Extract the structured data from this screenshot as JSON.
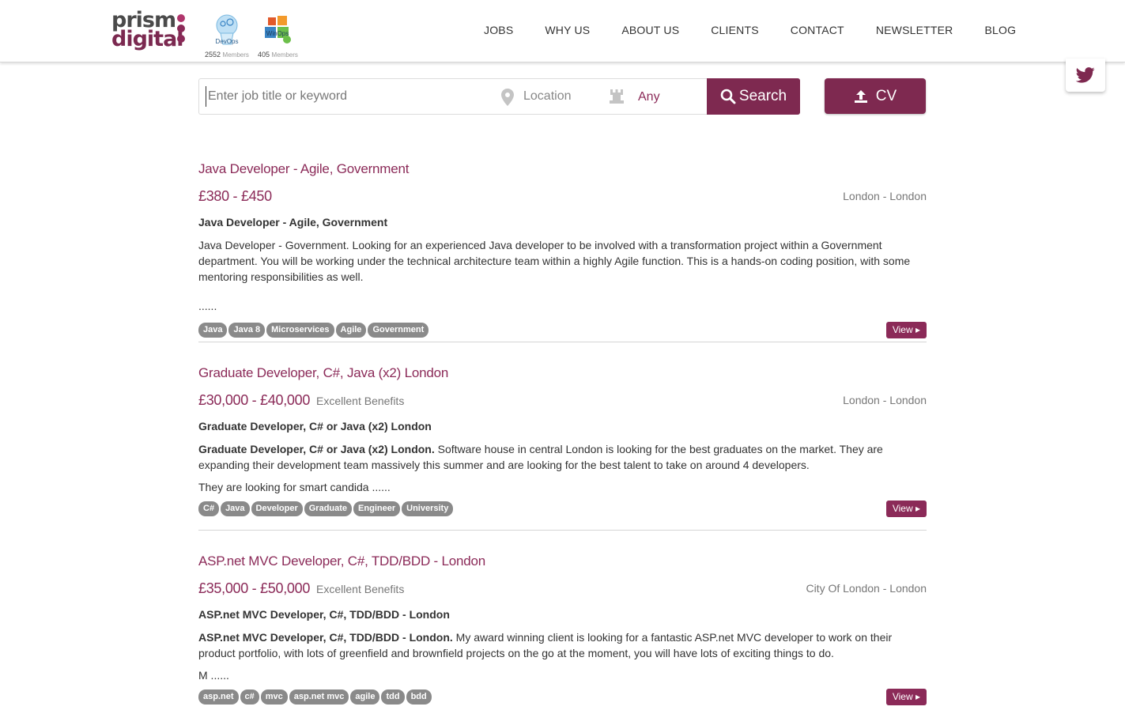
{
  "brand": {
    "logo_line1": "prism",
    "logo_line2": "digital"
  },
  "communities": [
    {
      "name": "DevOps",
      "count": "2552",
      "unit": "Members"
    },
    {
      "name": "WinOps",
      "count": "405",
      "unit": "Members"
    }
  ],
  "nav": [
    "JOBS",
    "WHY US",
    "ABOUT US",
    "CLIENTS",
    "CONTACT",
    "NEWSLETTER",
    "BLOG"
  ],
  "search": {
    "keyword_placeholder": "Enter job title or keyword",
    "location_label": "Location",
    "type_value": "Any",
    "search_label": "Search",
    "cv_label": "CV"
  },
  "jobs": [
    {
      "title": "Java Developer - Agile, Government",
      "salary": "£380 - £450",
      "benefits": "",
      "location": "London - London",
      "subtitle": "Java Developer - Agile, Government",
      "desc_bold": "",
      "desc": "Java Developer - Government. Looking for an experienced Java developer to be involved with a transformation project within a Government department. You will be working under the technical architecture team within a highly Agile function. This is a hands-on coding position, with some mentoring responsibilities as well.",
      "more": "......",
      "tags": [
        "Java",
        "Java 8",
        "Microservices",
        "Agile",
        "Government"
      ],
      "view_label": "View"
    },
    {
      "title": "Graduate Developer, C#, Java (x2) London",
      "salary": "£30,000 - £40,000",
      "benefits": "Excellent Benefits",
      "location": "London - London",
      "subtitle": "Graduate Developer, C# or Java (x2) London",
      "desc_bold": "Graduate Developer, C# or Java (x2) London.",
      "desc": " Software house in central London is looking for the best graduates on the market. They are expanding their development team massively this summer and are looking for the best talent to take on around 4 developers.",
      "more": "They are looking for smart candida ......",
      "tags": [
        "C#",
        "Java",
        "Developer",
        "Graduate",
        "Engineer",
        "University"
      ],
      "view_label": "View"
    },
    {
      "title": "ASP.net MVC Developer, C#, TDD/BDD - London",
      "salary": "£35,000 - £50,000",
      "benefits": "Excellent Benefits",
      "location": "City Of London - London",
      "subtitle": "ASP.net MVC Developer, C#, TDD/BDD - London",
      "desc_bold": "ASP.net MVC Developer, C#, TDD/BDD - London.",
      "desc": " My award winning client is looking for a fantastic ASP.net MVC developer to work on their product portfolio, with lots of greenfield and brownfield projects on the go at the moment, you will have lots of exciting things to do.",
      "more": "M ......",
      "tags": [
        "asp.net",
        "c#",
        "mvc",
        "asp.net mvc",
        "agile",
        "tdd",
        "bdd"
      ],
      "view_label": "View"
    }
  ],
  "colors": {
    "brand": "#8b2a58",
    "button": "#7e2950",
    "tag": "#8a8a8a"
  },
  "icons": [
    "twitter-icon",
    "location-pin-icon",
    "job-type-icon",
    "search-icon",
    "upload-icon",
    "caret-right-icon"
  ]
}
